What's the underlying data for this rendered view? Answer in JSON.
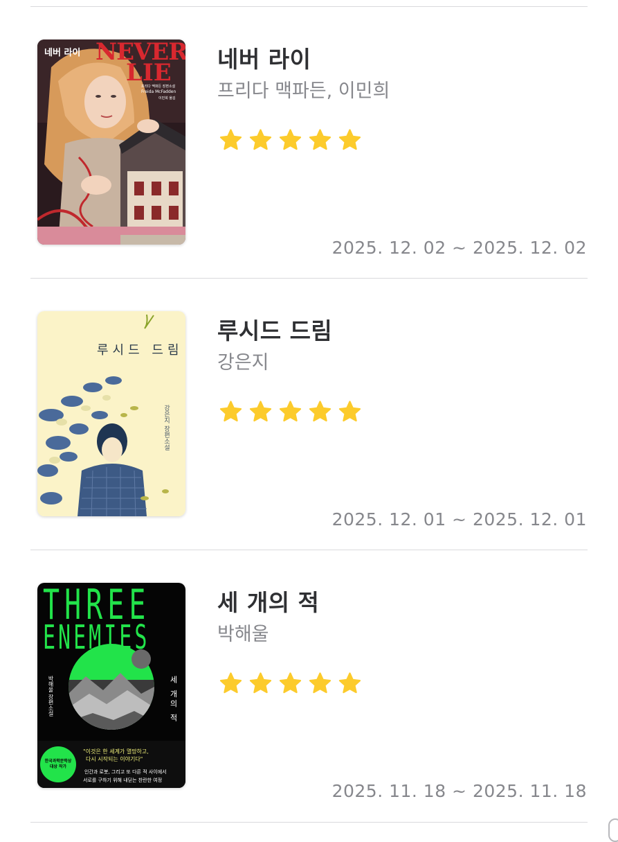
{
  "books": [
    {
      "title": "네버 라이",
      "author": "프리다 맥파든, 이민희",
      "rating": 5,
      "date_range": "2025. 12. 02 ~ 2025. 12. 02",
      "cover": {
        "title_ko": "네버 라이",
        "title_en_1": "NEVER",
        "title_en_2": "LIE",
        "author_line": "프리다 맥파든 장편소설",
        "author_en": "Freida McFadden",
        "translator": "이민희 옮김"
      }
    },
    {
      "title": "루시드 드림",
      "author": "강은지",
      "rating": 5,
      "date_range": "2025. 12. 01 ~ 2025. 12. 01",
      "cover": {
        "title_ko": "루시드 드림",
        "author_line": "강은지 장편소설"
      }
    },
    {
      "title": "세 개의 적",
      "author": "박해울",
      "rating": 5,
      "date_range": "2025. 11. 18 ~ 2025. 11. 18",
      "cover": {
        "title_en_1": "THREE",
        "title_en_2": "ENEMIES",
        "title_ko": "세 개의 적",
        "author_line": "박해울 장편소설",
        "quote_1": "\"이것은 한 세계가 멸망하고,",
        "quote_2": "다시 시작되는 이야기다\"",
        "blurb_1": "인간과 로봇, 그리고 또 다른 적 사이에서",
        "blurb_2": "서로를 구하기 위해 내딛는 찬란한 여정",
        "badge": "한국과학문학상 대상 작가"
      }
    }
  ],
  "colors": {
    "star": "#fccb2c",
    "title": "#2f3033",
    "secondary": "#86878c",
    "divider": "#d9d9dc",
    "three_enemies_green": "#22e34a"
  }
}
